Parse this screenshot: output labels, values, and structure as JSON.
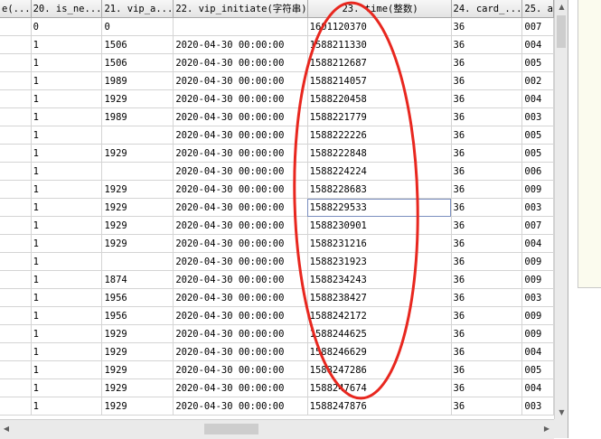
{
  "columns": [
    "e(...",
    "20. is_ne...",
    "21. vip_a...",
    "22. vip_initiate(字符串)",
    "23. time(整数)",
    "24. card_...",
    "25. a"
  ],
  "rows": [
    [
      "",
      "0",
      "0",
      "",
      "1601120370",
      "36",
      "007"
    ],
    [
      "",
      "1",
      "1506",
      "2020-04-30 00:00:00",
      "1588211330",
      "36",
      "004"
    ],
    [
      "",
      "1",
      "1506",
      "2020-04-30 00:00:00",
      "1588212687",
      "36",
      "005"
    ],
    [
      "",
      "1",
      "1989",
      "2020-04-30 00:00:00",
      "1588214057",
      "36",
      "002"
    ],
    [
      "",
      "1",
      "1929",
      "2020-04-30 00:00:00",
      "1588220458",
      "36",
      "004"
    ],
    [
      "",
      "1",
      "1989",
      "2020-04-30 00:00:00",
      "1588221779",
      "36",
      "003"
    ],
    [
      "",
      "1",
      "",
      "2020-04-30 00:00:00",
      "1588222226",
      "36",
      "005"
    ],
    [
      "",
      "1",
      "1929",
      "2020-04-30 00:00:00",
      "1588222848",
      "36",
      "005"
    ],
    [
      "",
      "1",
      "",
      "2020-04-30 00:00:00",
      "1588224224",
      "36",
      "006"
    ],
    [
      "",
      "1",
      "1929",
      "2020-04-30 00:00:00",
      "1588228683",
      "36",
      "009"
    ],
    [
      "",
      "1",
      "1929",
      "2020-04-30 00:00:00",
      "1588229533",
      "36",
      "003"
    ],
    [
      "",
      "1",
      "1929",
      "2020-04-30 00:00:00",
      "1588230901",
      "36",
      "007"
    ],
    [
      "",
      "1",
      "1929",
      "2020-04-30 00:00:00",
      "1588231216",
      "36",
      "004"
    ],
    [
      "",
      "1",
      "",
      "2020-04-30 00:00:00",
      "1588231923",
      "36",
      "009"
    ],
    [
      "",
      "1",
      "1874",
      "2020-04-30 00:00:00",
      "1588234243",
      "36",
      "009"
    ],
    [
      "",
      "1",
      "1956",
      "2020-04-30 00:00:00",
      "1588238427",
      "36",
      "003"
    ],
    [
      "",
      "1",
      "1956",
      "2020-04-30 00:00:00",
      "1588242172",
      "36",
      "009"
    ],
    [
      "",
      "1",
      "1929",
      "2020-04-30 00:00:00",
      "1588244625",
      "36",
      "009"
    ],
    [
      "",
      "1",
      "1929",
      "2020-04-30 00:00:00",
      "1588246629",
      "36",
      "004"
    ],
    [
      "",
      "1",
      "1929",
      "2020-04-30 00:00:00",
      "1588247286",
      "36",
      "005"
    ],
    [
      "",
      "1",
      "1929",
      "2020-04-30 00:00:00",
      "1588247674",
      "36",
      "004"
    ],
    [
      "",
      "1",
      "1929",
      "2020-04-30 00:00:00",
      "1588247876",
      "36",
      "003"
    ]
  ],
  "selected_cell": {
    "row": 10,
    "col": 4
  },
  "icons": {
    "scroll_up": "▲",
    "scroll_down": "▼",
    "scroll_left": "◀",
    "scroll_right": "▶"
  },
  "colors": {
    "annotation": "#e8271f",
    "selection": "#7b8fbf",
    "header_bg": "#e9e9e9"
  }
}
